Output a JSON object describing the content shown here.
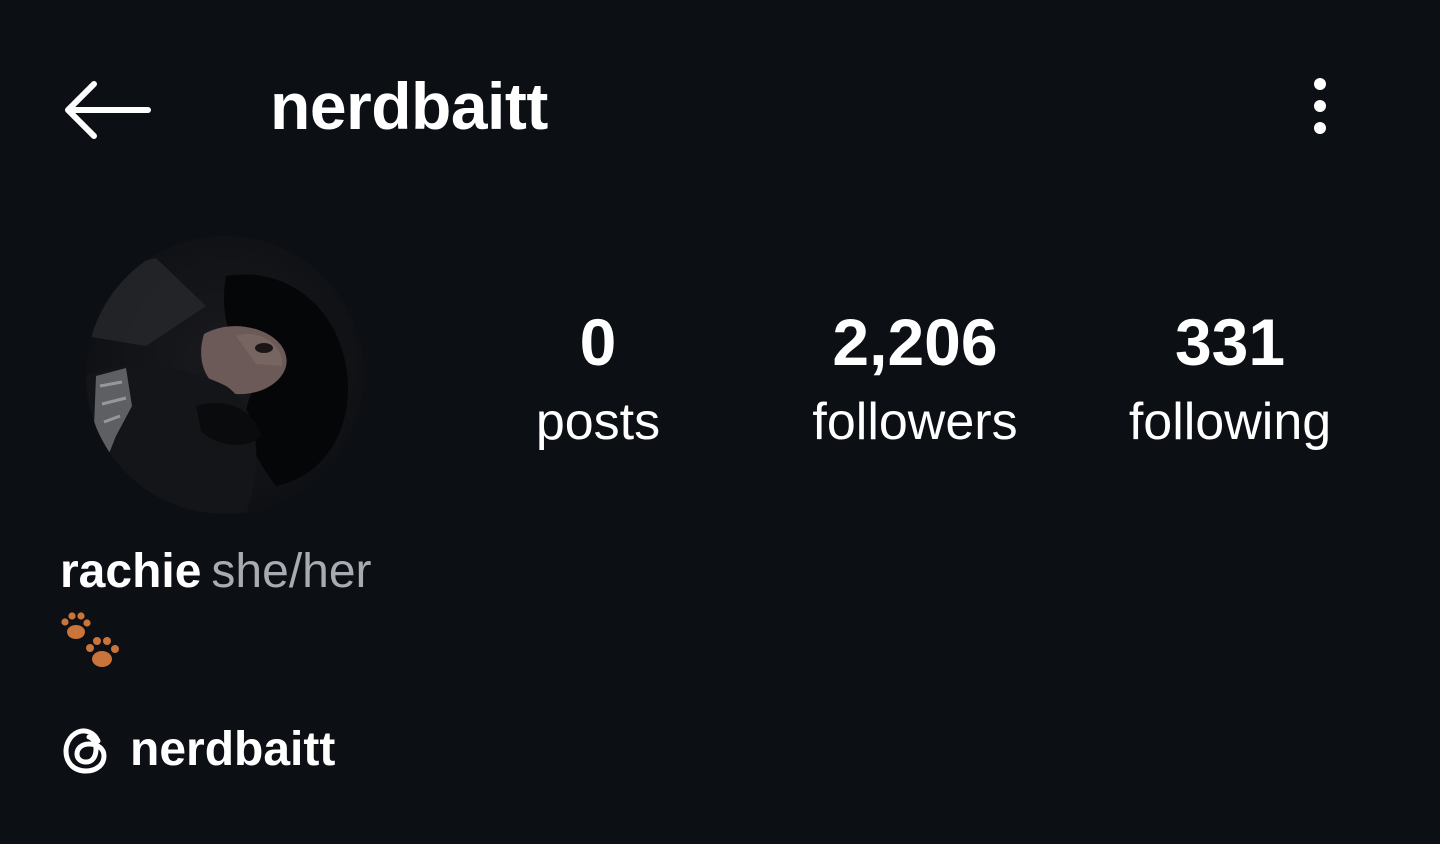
{
  "header": {
    "username": "nerdbaitt",
    "back_icon": "arrow-left-icon",
    "more_icon": "more-vertical-icon"
  },
  "profile": {
    "avatar_icon": "profile-photo",
    "stats": [
      {
        "value": "0",
        "label": "posts"
      },
      {
        "value": "2,206",
        "label": "followers"
      },
      {
        "value": "331",
        "label": "following"
      }
    ]
  },
  "bio": {
    "display_name": "rachie",
    "pronouns": "she/her",
    "emoji_icon": "paw-prints-icon"
  },
  "threads": {
    "icon": "threads-icon",
    "handle": "nerdbaitt"
  },
  "colors": {
    "background": "#0c0f14",
    "text_primary": "#ffffff",
    "text_secondary": "#a8abb2",
    "paw": "#c8743a"
  }
}
